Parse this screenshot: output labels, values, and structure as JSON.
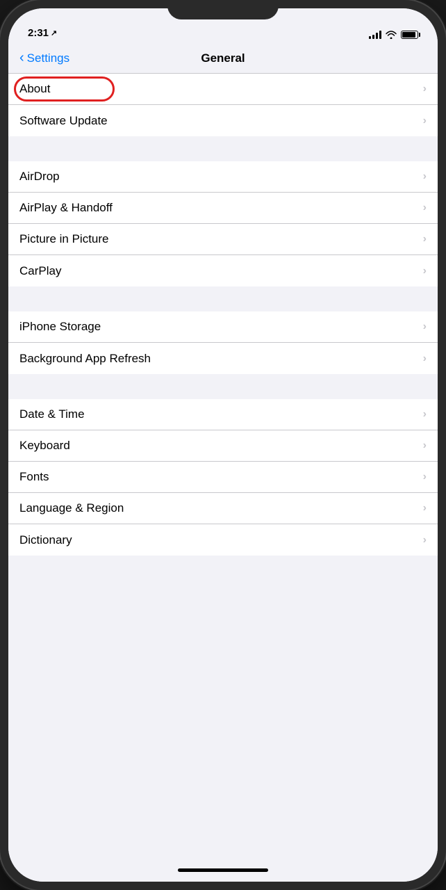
{
  "status_bar": {
    "time": "2:31",
    "location_indicator": "↗"
  },
  "nav": {
    "back_label": "Settings",
    "title": "General"
  },
  "sections": [
    {
      "id": "group1",
      "items": [
        {
          "id": "about",
          "label": "About",
          "highlighted": true
        },
        {
          "id": "software_update",
          "label": "Software Update",
          "highlighted": false
        }
      ]
    },
    {
      "id": "group2",
      "items": [
        {
          "id": "airdrop",
          "label": "AirDrop",
          "highlighted": false
        },
        {
          "id": "airplay_handoff",
          "label": "AirPlay & Handoff",
          "highlighted": false
        },
        {
          "id": "picture_in_picture",
          "label": "Picture in Picture",
          "highlighted": false
        },
        {
          "id": "carplay",
          "label": "CarPlay",
          "highlighted": false
        }
      ]
    },
    {
      "id": "group3",
      "items": [
        {
          "id": "iphone_storage",
          "label": "iPhone Storage",
          "highlighted": false
        },
        {
          "id": "background_app_refresh",
          "label": "Background App Refresh",
          "highlighted": false
        }
      ]
    },
    {
      "id": "group4",
      "items": [
        {
          "id": "date_time",
          "label": "Date & Time",
          "highlighted": false
        },
        {
          "id": "keyboard",
          "label": "Keyboard",
          "highlighted": false
        },
        {
          "id": "fonts",
          "label": "Fonts",
          "highlighted": false
        },
        {
          "id": "language_region",
          "label": "Language & Region",
          "highlighted": false
        },
        {
          "id": "dictionary",
          "label": "Dictionary",
          "highlighted": false
        }
      ]
    }
  ],
  "chevron": "›",
  "colors": {
    "accent": "#007aff",
    "highlight_ring": "#e02020",
    "separator": "#c8c8cc",
    "chevron": "#c7c7cc"
  }
}
